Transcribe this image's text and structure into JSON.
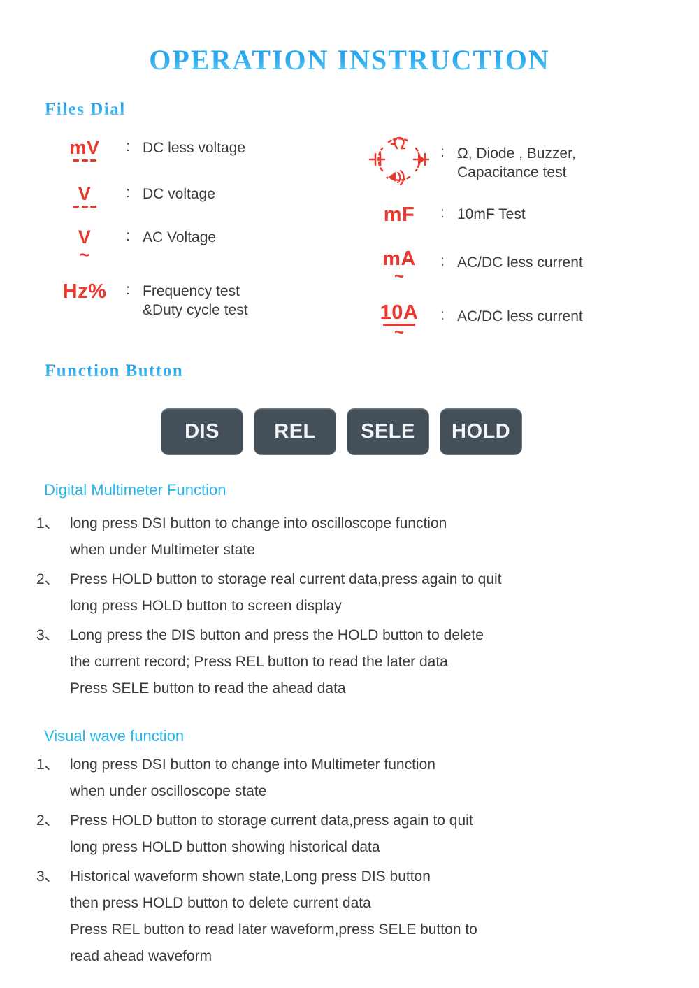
{
  "title": "OPERATION  INSTRUCTION",
  "sections": {
    "files_dial": {
      "heading": "Files  Dial",
      "left_items": [
        {
          "symbol_text": "mV",
          "symbol_kind": "dc",
          "desc": "DC less voltage"
        },
        {
          "symbol_text": "V",
          "symbol_kind": "dc",
          "desc": "DC voltage"
        },
        {
          "symbol_text": "V",
          "symbol_kind": "ac",
          "desc": "AC Voltage"
        },
        {
          "symbol_text": "Hz%",
          "symbol_kind": "plain",
          "desc": "Frequency test\n&Duty cycle test"
        }
      ],
      "right_items": [
        {
          "symbol_text": "",
          "symbol_kind": "dial-circle",
          "desc": "Ω, Diode , Buzzer,\nCapacitance test"
        },
        {
          "symbol_text": "mF",
          "symbol_kind": "plain",
          "desc": "10mF Test"
        },
        {
          "symbol_text": "mA",
          "symbol_kind": "acdc",
          "desc": "AC/DC less current"
        },
        {
          "symbol_text": "10A",
          "symbol_kind": "acdc-underline",
          "desc": "AC/DC less current"
        }
      ],
      "colon": ":"
    },
    "function_button": {
      "heading": "Function  Button",
      "buttons": [
        {
          "label": "DIS"
        },
        {
          "label": "REL"
        },
        {
          "label": "SELE"
        },
        {
          "label": "HOLD"
        }
      ]
    },
    "digital_multimeter": {
      "heading": "Digital Multimeter Function",
      "items": [
        {
          "num": "1、",
          "text": "long press DSI button to change into oscilloscope function\n   when under Multimeter state"
        },
        {
          "num": "2、",
          "text": "Press HOLD button to storage real current data,press again to quit\n  long press HOLD button to screen display"
        },
        {
          "num": "3、",
          "text": "Long press the DIS button and press the HOLD button to delete\n  the current record; Press REL button to read the later data\n Press SELE button to read the ahead data"
        }
      ]
    },
    "visual_wave": {
      "heading": "Visual wave function",
      "items": [
        {
          "num": "1、",
          "text": "long press DSI button to change into Multimeter function\n   when under oscilloscope state"
        },
        {
          "num": "2、",
          "text": "Press HOLD button to storage current data,press again to quit\n  long press HOLD button showing historical data"
        },
        {
          "num": "3、",
          "text": "Historical waveform shown state,Long press DIS button\n   then press HOLD button to delete current data\n  Press REL button to read later waveform,press SELE button to\n read ahead waveform"
        }
      ]
    }
  },
  "colors": {
    "heading_blue": "#29b4ec",
    "symbol_red": "#e9382e",
    "button_bg": "#434f59",
    "body_text": "#3b3b3b"
  }
}
